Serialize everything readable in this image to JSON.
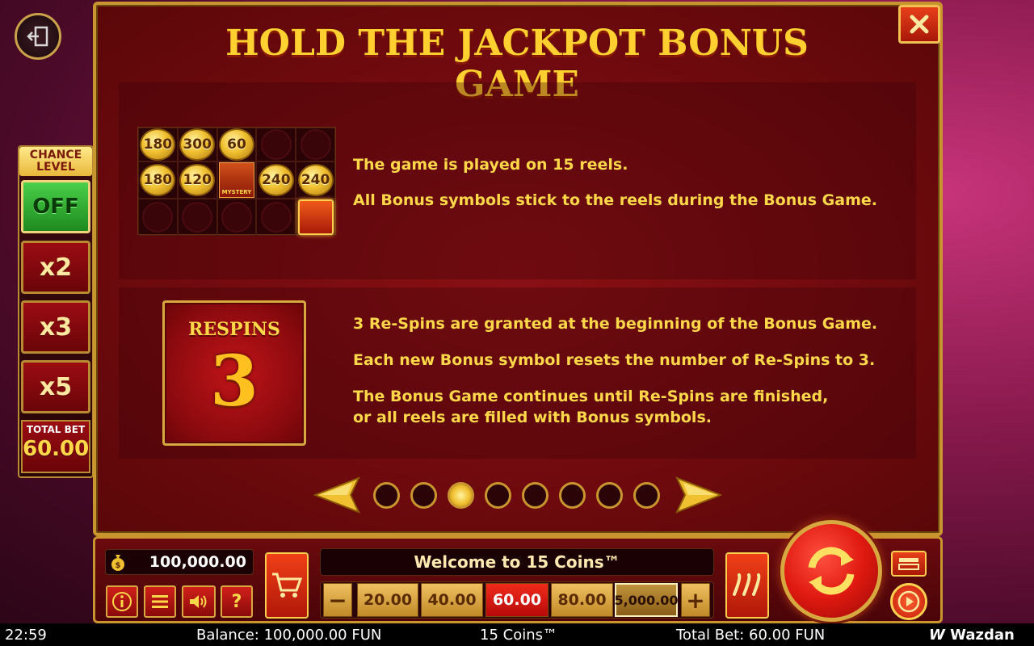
{
  "title": "HOLD THE JACKPOT BONUS GAME",
  "chance_level": {
    "title_line1": "CHANCE",
    "title_line2": "LEVEL",
    "options": [
      "OFF",
      "x2",
      "x3",
      "x5"
    ],
    "selected": "OFF",
    "total_bet_label": "TOTAL BET",
    "total_bet_value": "60.00"
  },
  "section1": {
    "lines": [
      "The game is played on 15 reels.",
      "All Bonus symbols stick to the reels during the Bonus Game."
    ],
    "grid": {
      "row1": [
        "180",
        "300",
        "60",
        "",
        ""
      ],
      "row2": [
        "180",
        "120",
        "MYSTERY",
        "240",
        "240"
      ],
      "row3": [
        "",
        "",
        "",
        "",
        "CHEST"
      ]
    }
  },
  "section2": {
    "respins_label": "RESPINS",
    "respins_count": "3",
    "lines": [
      "3 Re-Spins are granted at the beginning of the Bonus Game.",
      "Each new Bonus symbol resets the number of Re-Spins to 3.",
      "The Bonus Game continues until Re-Spins are finished,",
      "or all reels are filled with Bonus symbols."
    ]
  },
  "pagination": {
    "total_pages": 8,
    "current_page": 3
  },
  "bottom": {
    "balance": "100,000.00",
    "welcome": "Welcome to 15 Coins™",
    "bets": [
      "20.00",
      "40.00",
      "60.00",
      "80.00",
      "5,000.00"
    ],
    "selected_bet": "60.00",
    "info_label": "i",
    "help_label": "?",
    "minus_label": "−",
    "plus_label": "+"
  },
  "status": {
    "time": "22:59",
    "balance": "Balance: 100,000.00 FUN",
    "game_name": "15 Coins™",
    "total_bet": "Total Bet: 60.00 FUN",
    "brand": "Wazdan"
  },
  "colors": {
    "gold": "#ffd84a",
    "panel_red": "#6e0a0e",
    "border_gold": "#c9952e",
    "selected_bet_red": "#e01a10",
    "off_green": "#2aa82a"
  }
}
